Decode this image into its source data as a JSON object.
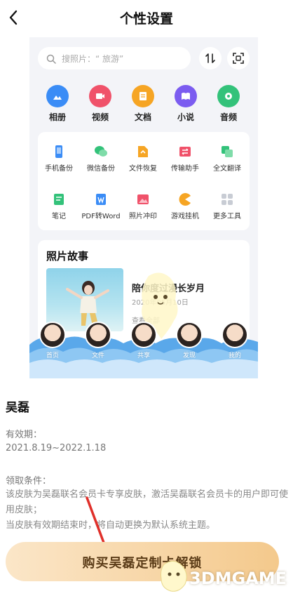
{
  "header": {
    "title": "个性设置"
  },
  "preview": {
    "search_placeholder": "搜照片：“ 旅游”",
    "categories": [
      {
        "label": "相册",
        "icon": "album-icon",
        "color": "#3a8cf6"
      },
      {
        "label": "视频",
        "icon": "video-icon",
        "color": "#f0526a"
      },
      {
        "label": "文档",
        "icon": "document-icon",
        "color": "#f6a524"
      },
      {
        "label": "小说",
        "icon": "book-icon",
        "color": "#7b5cf0"
      },
      {
        "label": "音频",
        "icon": "music-icon",
        "color": "#33c27a"
      }
    ],
    "tools_row1": [
      {
        "label": "手机备份",
        "icon": "phone-backup-icon",
        "color": "#3a8cf6"
      },
      {
        "label": "微信备份",
        "icon": "wechat-backup-icon",
        "color": "#33c27a"
      },
      {
        "label": "文件恢复",
        "icon": "file-restore-icon",
        "color": "#f6a524"
      },
      {
        "label": "传输助手",
        "icon": "transfer-icon",
        "color": "#f0526a"
      },
      {
        "label": "全文翻译",
        "icon": "translate-icon",
        "color": "#33c27a"
      }
    ],
    "tools_row2": [
      {
        "label": "笔记",
        "icon": "note-icon",
        "color": "#33c27a"
      },
      {
        "label": "PDF转Word",
        "icon": "pdf-word-icon",
        "color": "#3a8cf6"
      },
      {
        "label": "照片冲印",
        "icon": "photo-print-icon",
        "color": "#f0526a"
      },
      {
        "label": "游戏挂机",
        "icon": "game-icon",
        "color": "#f6a524"
      },
      {
        "label": "更多工具",
        "icon": "more-tools-icon",
        "color": "#c8ccd4"
      }
    ],
    "story": {
      "title": "照片故事",
      "caption": "陪你度过漫长岁月",
      "date": "2020年05月10日",
      "more": "查看全部"
    },
    "bottom_nav": [
      "首页",
      "文件",
      "共享",
      "发现",
      "我的"
    ]
  },
  "skin": {
    "name": "吴磊",
    "validity_label": "有效期：",
    "validity_value": "2021.8.19~2022.1.18",
    "conditions_label": "领取条件：",
    "conditions_text": "该皮肤为吴磊联名会员卡专享皮肤，激活吴磊联名会员卡的用户即可使用皮肤；",
    "expiry_note": "当皮肤有效期结束时，将自动更换为默认系统主题。"
  },
  "buy_button": {
    "label": "购买吴磊定制卡解锁"
  },
  "watermark": {
    "text": "3DMGAME"
  },
  "colors": {
    "accent_gold_start": "#fbe6c8",
    "accent_gold_end": "#f4c98c",
    "button_text": "#5a3b17",
    "arrow": "#e0302a"
  }
}
